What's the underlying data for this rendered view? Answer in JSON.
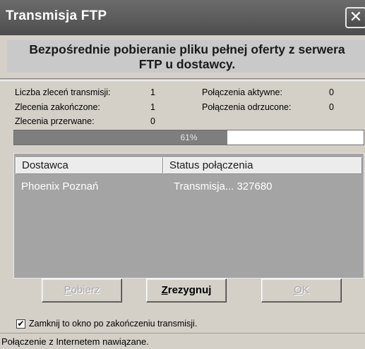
{
  "window": {
    "title": "Transmisja FTP"
  },
  "header": {
    "line1": "Bezpośrednie pobieranie pliku pełnej oferty z serwera",
    "line2": "FTP u dostawcy."
  },
  "stats": {
    "orders_label": "Liczba zleceń transmisji:",
    "orders_value": "1",
    "completed_label": "Zlecenia zakończone:",
    "completed_value": "1",
    "interrupted_label": "Zlecenia przerwane:",
    "interrupted_value": "0",
    "active_label": "Połączenia aktywne:",
    "active_value": "0",
    "rejected_label": "Połączenia odrzucone:",
    "rejected_value": "0"
  },
  "progress": {
    "label": "61%",
    "fraction": 0.61
  },
  "list": {
    "columns": [
      "Dostawca",
      "Status połączenia"
    ],
    "rows": [
      [
        "Phoenix Poznań",
        "Transmisja... 327680"
      ]
    ]
  },
  "buttons": {
    "download": {
      "hotkey": "P",
      "rest": "obierz",
      "enabled": false
    },
    "cancel": {
      "hotkey": "Z",
      "rest": "rezygnuj",
      "enabled": true
    },
    "ok": {
      "hotkey": "O",
      "rest": "K",
      "enabled": false
    }
  },
  "checkbox": {
    "checked": true,
    "label": "Zamknij to okno po zakończeniu transmisji."
  },
  "statusbar": {
    "text": "Połączenie z Internetem nawiązane."
  },
  "colors": {
    "titlebar": "#5a5a5a",
    "window_bg": "#d4d0c8",
    "list_bg": "#a4a4a4",
    "progress_fill": "#7e7e7e"
  }
}
